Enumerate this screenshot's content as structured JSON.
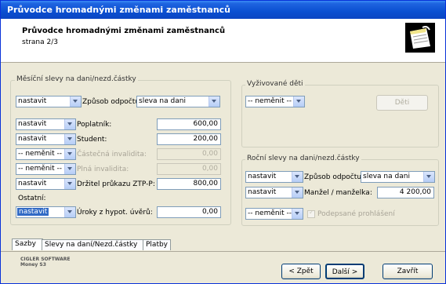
{
  "window": {
    "title": "Průvodce hromadnými změnami zaměstnanců"
  },
  "header": {
    "title": "Průvodce hromadnými změnami zaměstnanců",
    "step": "strana 2/3",
    "icon": "notepad-icon"
  },
  "monthly": {
    "group_label": "Měsíční slevy na dani/nezd.částky",
    "mode_value": "nastavit",
    "method_label": "Způsob odpočtu",
    "method_value": "sleva na dani",
    "rows": [
      {
        "action": "nastavit",
        "label": "Poplatník:",
        "value": "600,00"
      },
      {
        "action": "nastavit",
        "label": "Student:",
        "value": "200,00"
      },
      {
        "action": "-- neměnit --",
        "label": "Částečná invalidita:",
        "value": "0,00"
      },
      {
        "action": "-- neměnit --",
        "label": "Plná invalidita:",
        "value": "0,00"
      },
      {
        "action": "nastavit",
        "label": "Držitel průkazu ZTP-P:",
        "value": "800,00"
      }
    ],
    "other_label": "Ostatní:",
    "other_action": "nastavit",
    "mortgage_label": "Úroky z hypot. úvěrů:",
    "mortgage_value": "0,00"
  },
  "children": {
    "group_label": "Vyživované děti",
    "action": "-- neměnit --",
    "button_label": "Děti"
  },
  "annual": {
    "group_label": "Roční slevy na dani/nezd.částky",
    "mode_value": "nastavit",
    "method_label": "Způsob odpočtu",
    "method_value": "sleva na dani",
    "spouse_action": "nastavit",
    "spouse_label": "Manžel / manželka:",
    "spouse_value": "4 200,00",
    "signed_action": "-- neměnit --",
    "signed_label": "Podepsané prohlášení"
  },
  "tabs": [
    "Sazby",
    "Slevy na daní/Nezd.částky",
    "Platby"
  ],
  "footer": {
    "company_line1": "CIGLER SOFTWARE",
    "company_line2": "Money S3",
    "back": "< Zpět",
    "next": "Další >",
    "close": "Zavřít"
  }
}
